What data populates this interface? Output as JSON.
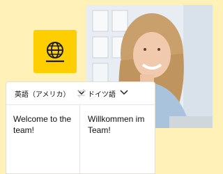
{
  "translator": {
    "source_lang": "英語（アメリカ）",
    "target_lang": "ドイツ語",
    "source_text": "Welcome to the team!",
    "target_text": "Willkommen im Team!"
  },
  "icons": {
    "badge": "globe-icon",
    "swap": "swap-arrows-icon",
    "dropdown": "chevron-down-icon"
  },
  "colors": {
    "background": "#fff1b8",
    "badge": "#ffce00",
    "card": "#ffffff"
  }
}
